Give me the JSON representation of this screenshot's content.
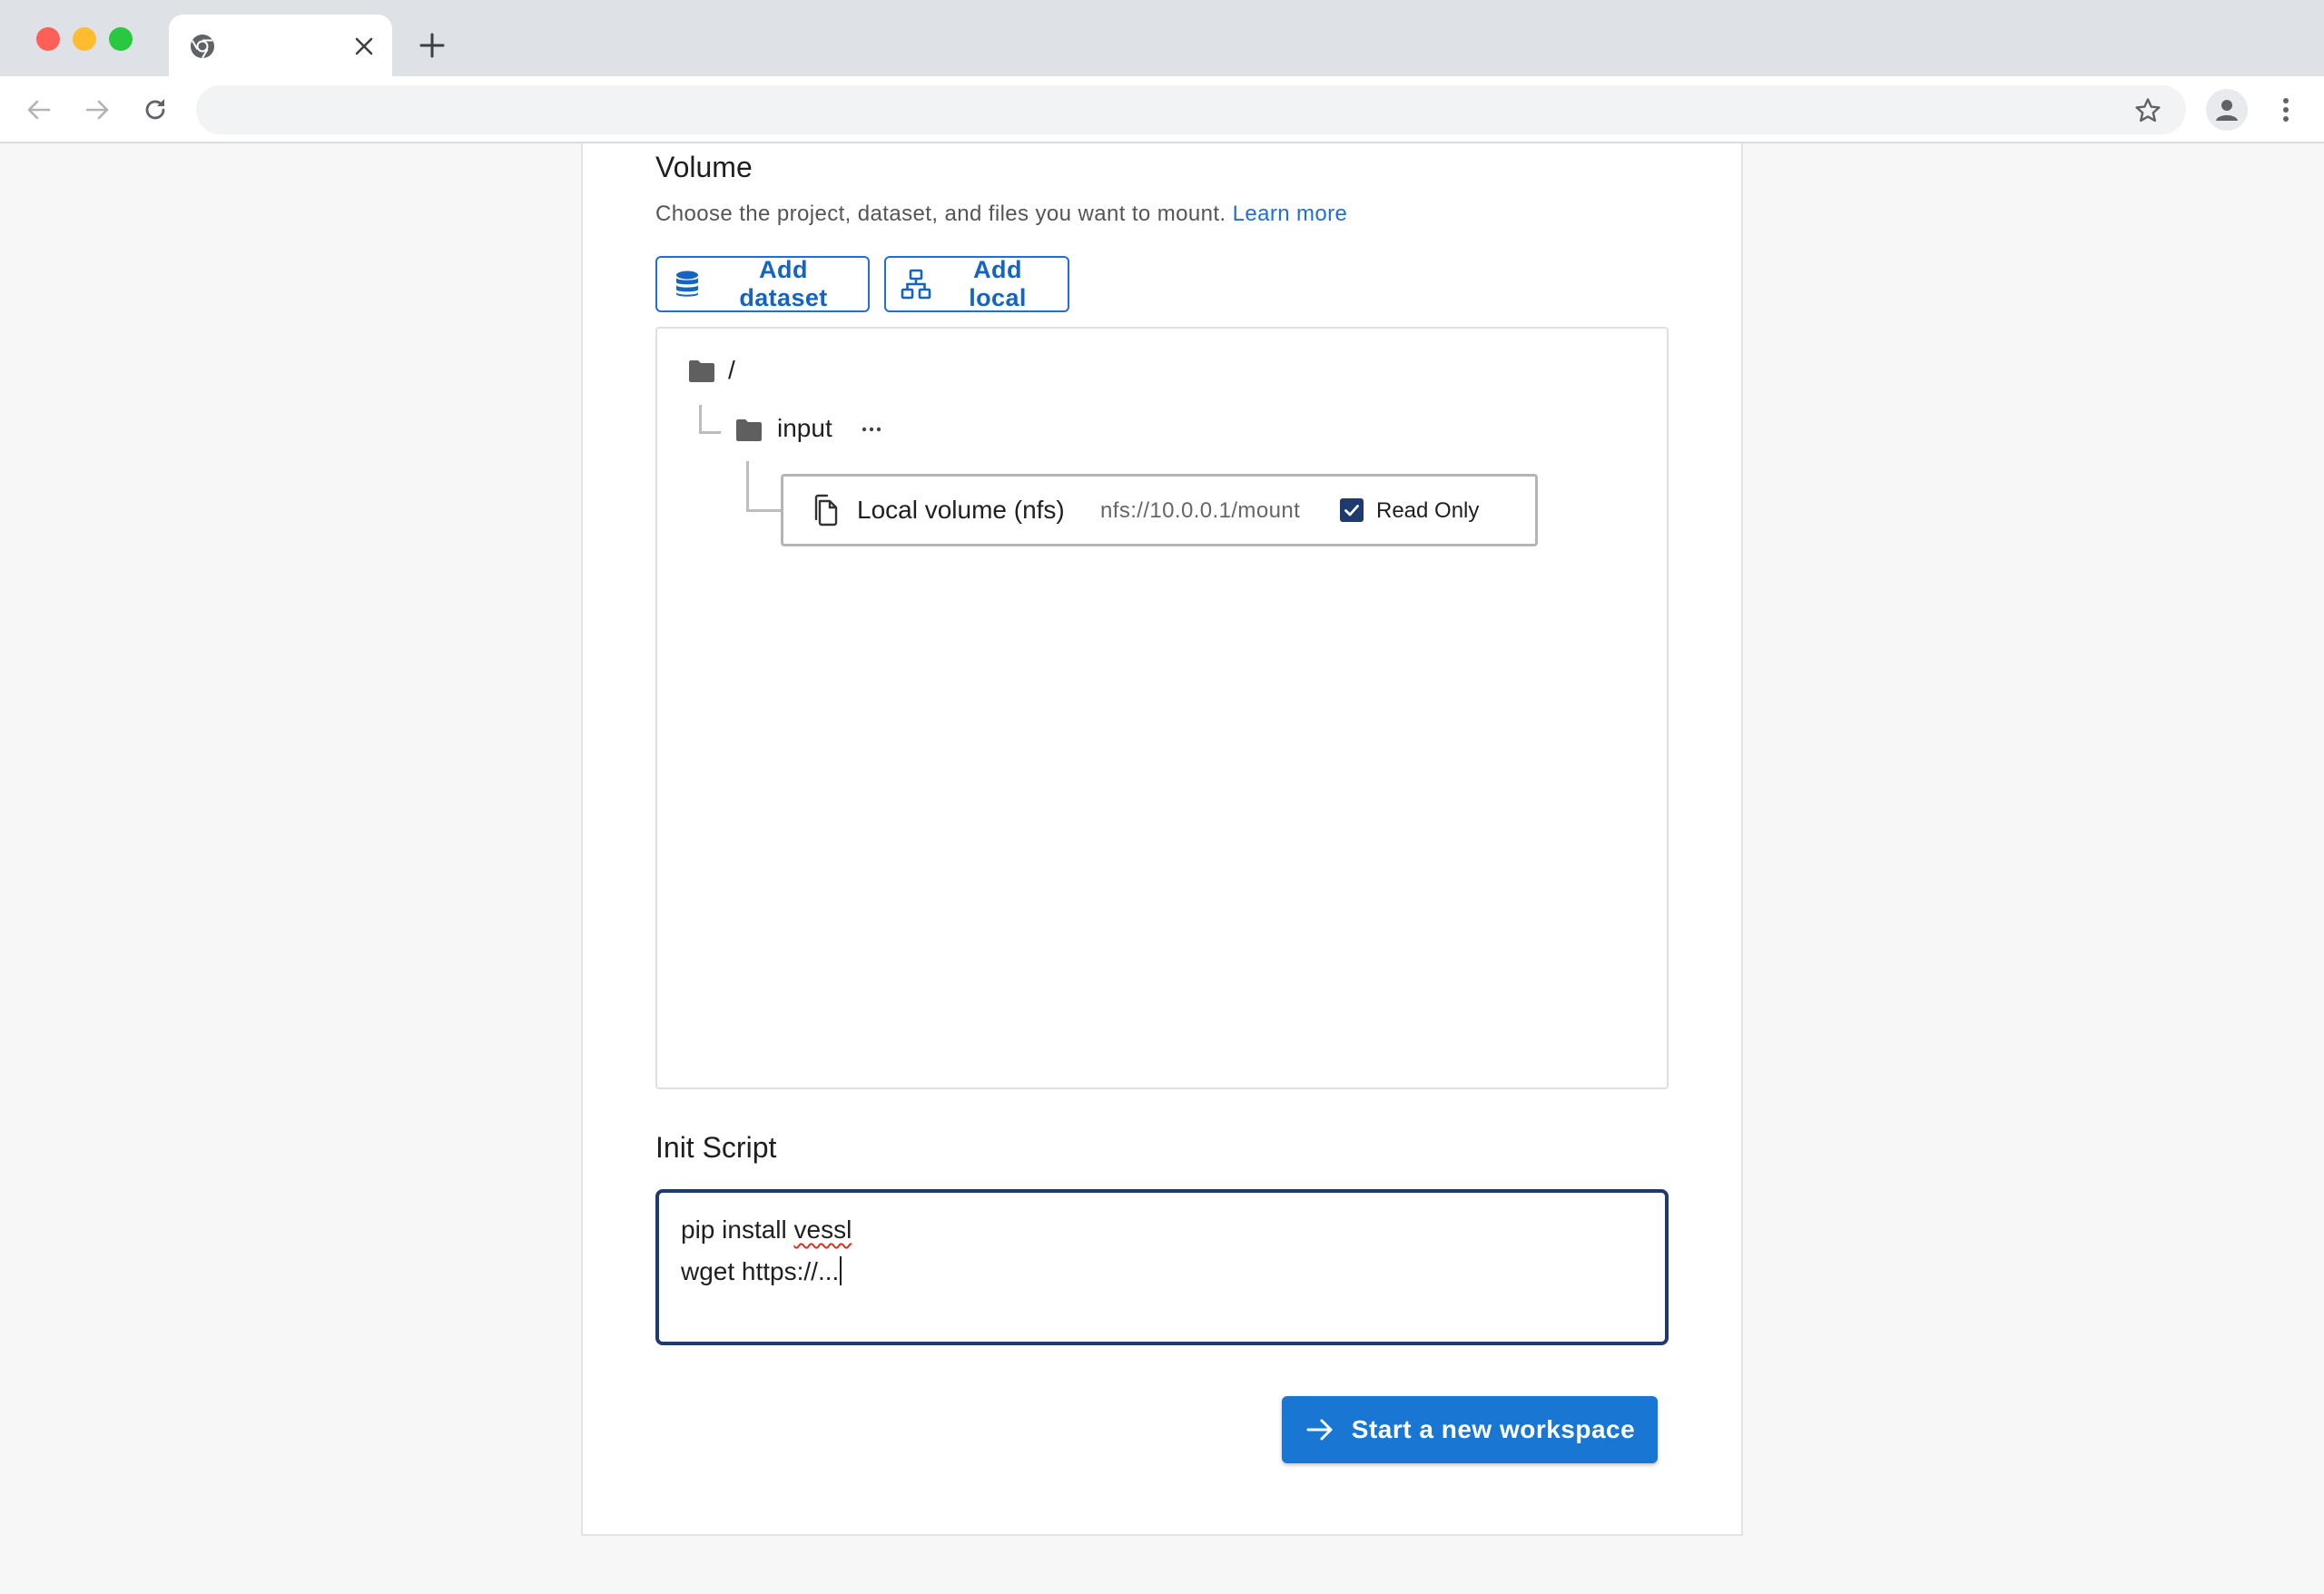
{
  "browser": {
    "tab_title": "",
    "address_value": "",
    "address_placeholder": ""
  },
  "volume": {
    "title": "Volume",
    "description": "Choose the project, dataset, and files you want to mount.",
    "learn_more": "Learn more",
    "add_dataset_label": "Add dataset",
    "add_local_label": "Add local",
    "tree": {
      "root_label": "/",
      "folder_label": "input",
      "item": {
        "name": "Local volume (nfs)",
        "path": "nfs://10.0.0.1/mount",
        "read_only_label": "Read Only",
        "read_only_checked": true
      }
    }
  },
  "init_script": {
    "title": "Init Script",
    "line1_prefix": "pip install ",
    "line1_word": "vessl",
    "line2": "wget https://..."
  },
  "actions": {
    "start_label": "Start a new workspace"
  },
  "colors": {
    "primary": "#1976d2",
    "link": "#1f6fd6",
    "focus_border": "#1f3a6e"
  },
  "icons": {
    "dataset": "database-icon",
    "local": "network-tree-icon",
    "folder": "folder-icon",
    "more": "more-horizontal-icon",
    "volume": "copy-icon",
    "check": "checkmark-icon",
    "start": "arrow-right-icon"
  }
}
